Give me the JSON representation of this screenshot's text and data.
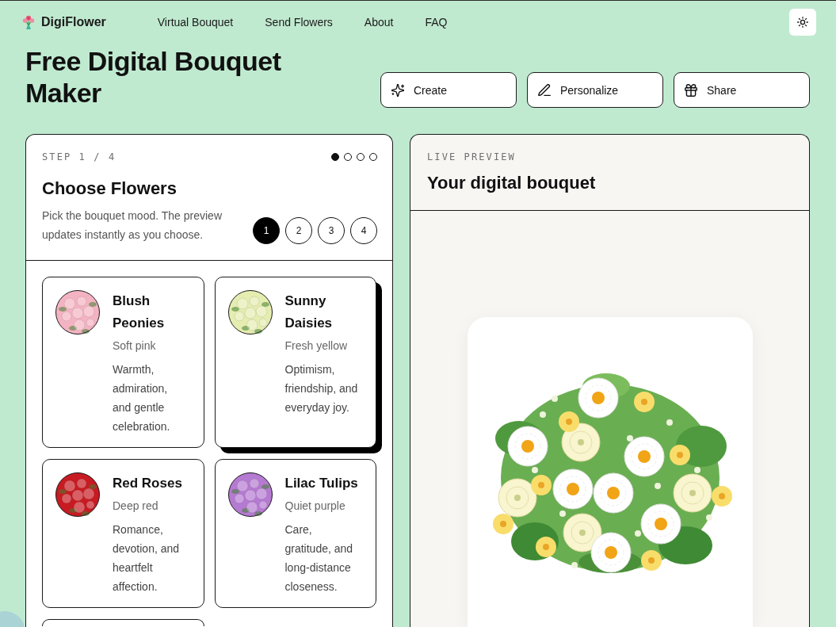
{
  "nav": {
    "brand": "DigiFlower",
    "links": [
      "Virtual Bouquet",
      "Send Flowers",
      "About",
      "FAQ"
    ]
  },
  "hero": {
    "title": "Free Digital Bouquet Maker",
    "actions": [
      "Create",
      "Personalize",
      "Share"
    ]
  },
  "builder": {
    "step_label": "STEP 1 / 4",
    "progress_dots": [
      {
        "selected": true
      },
      {
        "selected": false
      },
      {
        "selected": false
      },
      {
        "selected": false
      }
    ],
    "title": "Choose Flowers",
    "description": "Pick the bouquet mood. The preview updates instantly as you choose.",
    "steps": [
      {
        "label": "1",
        "selected": true
      },
      {
        "label": "2",
        "selected": false
      },
      {
        "label": "3",
        "selected": false
      },
      {
        "label": "4",
        "selected": false
      }
    ],
    "flowers": [
      {
        "name": "Blush Peonies",
        "tone": "Soft pink",
        "meaning": "Warmth, admiration, and gentle celebration.",
        "color": "#f4b3c2",
        "selected": false
      },
      {
        "name": "Sunny Daisies",
        "tone": "Fresh yellow",
        "meaning": "Optimism, friendship, and everyday joy.",
        "color": "#e6edb0",
        "selected": true
      },
      {
        "name": "Red Roses",
        "tone": "Deep red",
        "meaning": "Romance, devotion, and heartfelt affection.",
        "color": "#c81a22",
        "selected": false
      },
      {
        "name": "Lilac Tulips",
        "tone": "Quiet purple",
        "meaning": "Care, gratitude, and long-distance closeness.",
        "color": "#b57ad2",
        "selected": false
      }
    ]
  },
  "preview": {
    "eyebrow": "LIVE PREVIEW",
    "title": "Your digital bouquet"
  }
}
